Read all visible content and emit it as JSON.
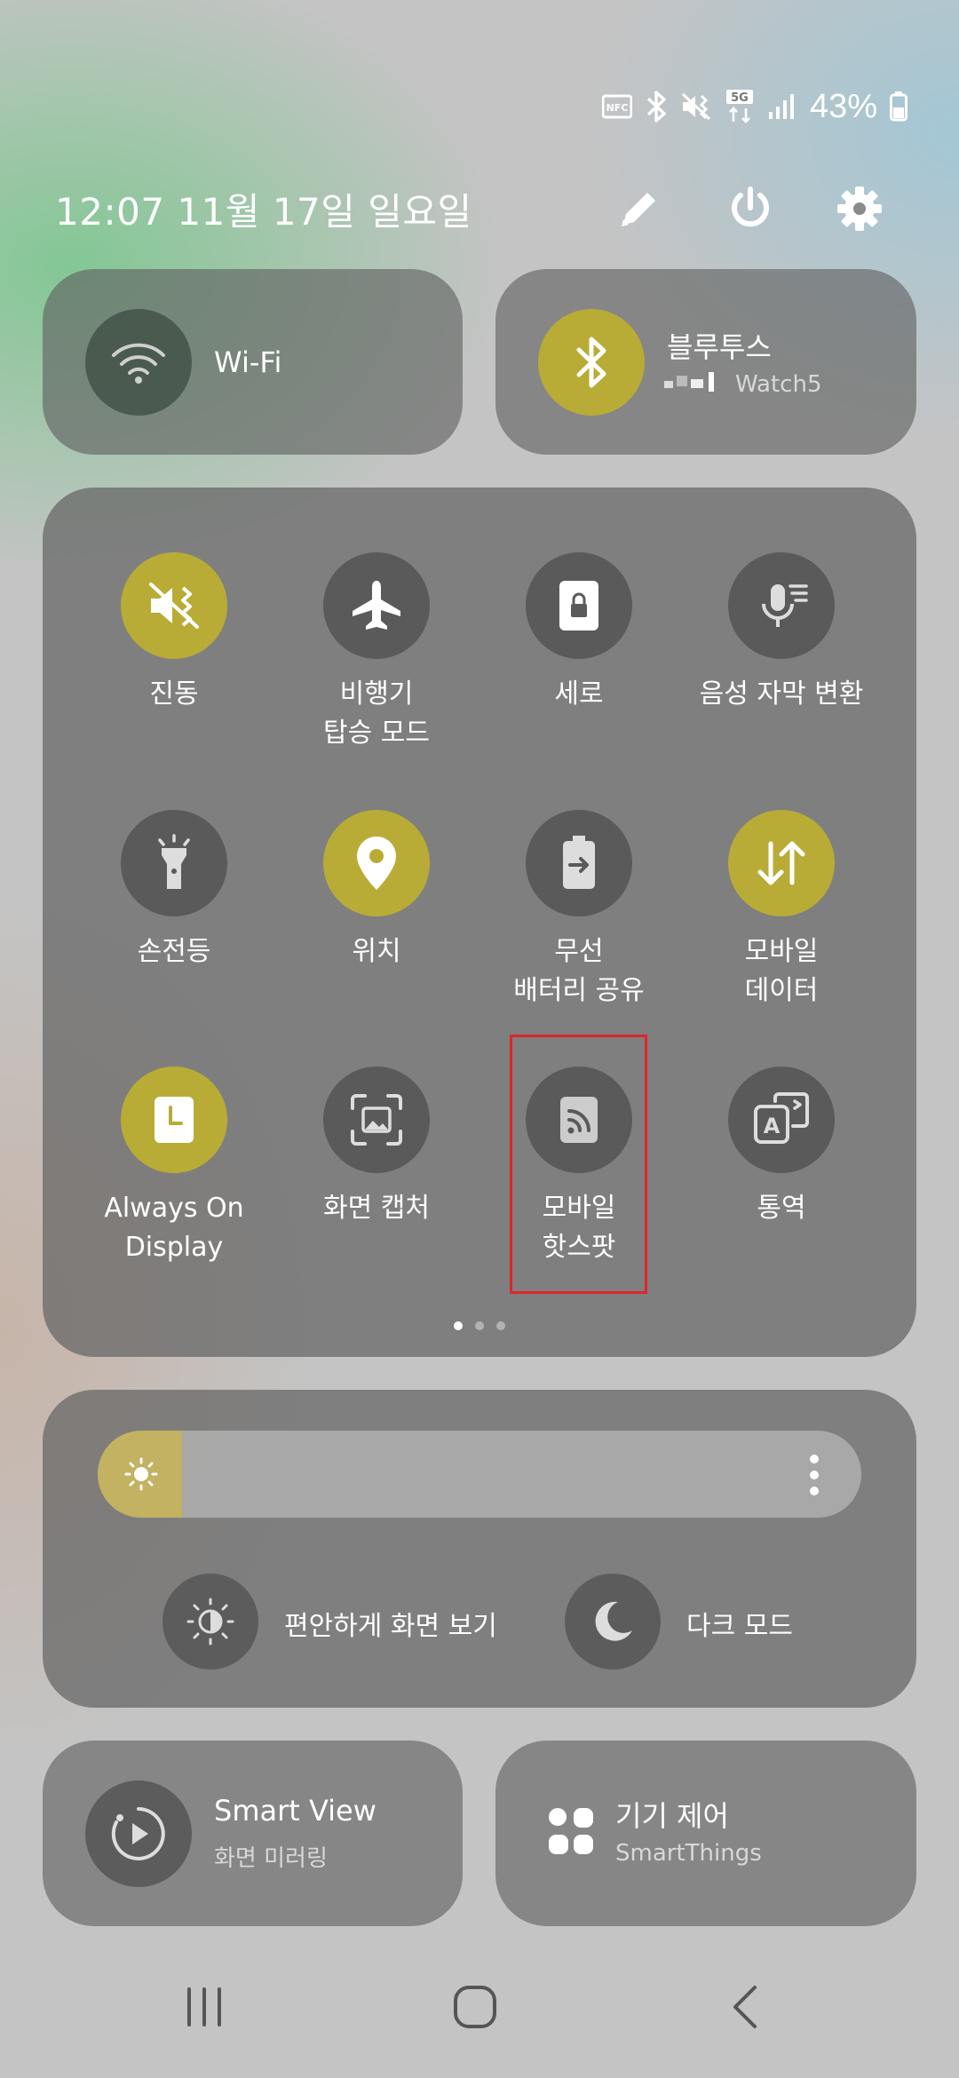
{
  "status_bar": {
    "battery_text": "43%",
    "icons": [
      "nfc-icon",
      "bluetooth-icon",
      "vibrate-icon",
      "5g-icon",
      "signal-icon",
      "battery-icon"
    ]
  },
  "header": {
    "datetime": "12:07  11월 17일 일요일",
    "icons": [
      "edit-icon",
      "power-icon",
      "settings-icon"
    ]
  },
  "wifi": {
    "title": "Wi-Fi",
    "state": "off"
  },
  "bluetooth": {
    "title": "블루투스",
    "subtitle": "Watch5",
    "state": "on"
  },
  "quick_tiles": [
    {
      "label": "진동",
      "icon": "vibrate-icon",
      "state": "on"
    },
    {
      "label": "비행기\n탑승 모드",
      "icon": "airplane-icon",
      "state": "off"
    },
    {
      "label": "세로",
      "icon": "portrait-lock-icon",
      "state": "off"
    },
    {
      "label": "음성 자막 변환",
      "icon": "live-caption-icon",
      "state": "off"
    },
    {
      "label": "손전등",
      "icon": "flashlight-icon",
      "state": "off"
    },
    {
      "label": "위치",
      "icon": "location-icon",
      "state": "on"
    },
    {
      "label": "무선\n배터리 공유",
      "icon": "wireless-battery-icon",
      "state": "off"
    },
    {
      "label": "모바일\n데이터",
      "icon": "mobile-data-icon",
      "state": "on"
    },
    {
      "label": "Always On\nDisplay",
      "icon": "always-on-display-icon",
      "state": "on"
    },
    {
      "label": "화면 캡처",
      "icon": "screen-capture-icon",
      "state": "off"
    },
    {
      "label": "모바일\n핫스팟",
      "icon": "hotspot-icon",
      "state": "off"
    },
    {
      "label": "통역",
      "icon": "interpreter-icon",
      "state": "off"
    }
  ],
  "page_indicator": {
    "current": 1,
    "total": 3
  },
  "brightness": {
    "level": 0.11,
    "more_icon": "more-vert-icon"
  },
  "display_options": {
    "eye_comfort_label": "편안하게 화면 보기",
    "dark_mode_label": "다크 모드"
  },
  "smart_view": {
    "title": "Smart View",
    "subtitle": "화면 미러링"
  },
  "device_control": {
    "title": "기기 제어",
    "subtitle": "SmartThings"
  },
  "colors": {
    "accent_on": "#b8ac36",
    "tile_off": "#5a5a5a",
    "highlight": "#e0242a"
  }
}
